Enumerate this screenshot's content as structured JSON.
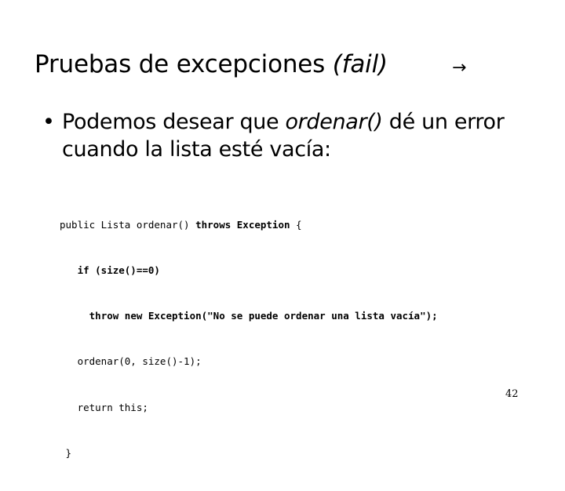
{
  "slide": {
    "title": {
      "text_plain": "Pruebas de excepciones ",
      "text_italic": "(fail)",
      "full": "Pruebas de excepciones (fail)"
    },
    "title_marker_icon": "→",
    "bullets": [
      {
        "marker": "•",
        "segments": [
          {
            "text": "Podemos desear que ",
            "style": "normal"
          },
          {
            "text": "ordenar()",
            "style": "italic"
          },
          {
            "text": " dé un error cuando la lista esté vacía:",
            "style": "normal"
          }
        ],
        "full_text": "Podemos desear que ordenar() dé un error cuando la lista esté vacía:"
      }
    ],
    "code": {
      "language": "java",
      "lines": [
        {
          "indent": "",
          "parts": [
            {
              "text": "public Lista ordenar() ",
              "weight": "normal"
            },
            {
              "text": "throws Exception",
              "weight": "bold"
            },
            {
              "text": " {",
              "weight": "normal"
            }
          ],
          "plain": "public Lista ordenar() throws Exception {"
        },
        {
          "indent": "   ",
          "parts": [
            {
              "text": "if (size()==0)",
              "weight": "bold"
            }
          ],
          "plain": "   if (size()==0)"
        },
        {
          "indent": "     ",
          "parts": [
            {
              "text": "throw new Exception(\"No se puede ordenar una lista vacía\");",
              "weight": "bold"
            }
          ],
          "plain": "     throw new Exception(\"No se puede ordenar una lista vacía\");"
        },
        {
          "indent": "   ",
          "parts": [
            {
              "text": "ordenar(0, size()-1);",
              "weight": "normal"
            }
          ],
          "plain": "   ordenar(0, size()-1);"
        },
        {
          "indent": "   ",
          "parts": [
            {
              "text": "return this;",
              "weight": "normal"
            }
          ],
          "plain": "   return this;"
        },
        {
          "indent": " ",
          "parts": [
            {
              "text": "}",
              "weight": "normal"
            }
          ],
          "plain": " }"
        }
      ]
    },
    "page_number": "42",
    "colors": {
      "background": "#ffffff",
      "text": "#000000"
    }
  }
}
